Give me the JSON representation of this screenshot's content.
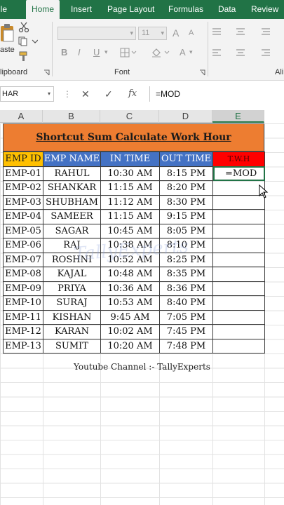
{
  "ribbon": {
    "tabs": [
      {
        "label": "ile",
        "active": false
      },
      {
        "label": "Home",
        "active": true
      },
      {
        "label": "Insert",
        "active": false
      },
      {
        "label": "Page Layout",
        "active": false
      },
      {
        "label": "Formulas",
        "active": false
      },
      {
        "label": "Data",
        "active": false
      },
      {
        "label": "Review",
        "active": false
      }
    ],
    "paste_label": "aste",
    "clipboard_label": "lipboard",
    "font_group_label": "Font",
    "align_group_label": "Ali",
    "font_size_value": "11",
    "bold_label": "B",
    "italic_label": "I",
    "underline_label": "U",
    "grow_font_label": "A",
    "shrink_font_label": "A",
    "font_color_label": "A"
  },
  "formula_bar": {
    "name_box": "HAR",
    "formula": "=MOD"
  },
  "columns": [
    "A",
    "B",
    "C",
    "D",
    "E"
  ],
  "active_column": "E",
  "sheet": {
    "title": "Shortcut Sum Calculate Work Hour",
    "headers": [
      "EMP ID",
      "EMP NAME",
      "IN TIME",
      "OUT TIME",
      "T.W.H"
    ],
    "rows": [
      [
        "EMP-01",
        "RAHUL",
        "10:30 AM",
        "8:15 PM",
        "=MOD"
      ],
      [
        "EMP-02",
        "SHANKAR",
        "11:15 AM",
        "8:20 PM",
        ""
      ],
      [
        "EMP-03",
        "SHUBHAM",
        "11:12 AM",
        "8:30 PM",
        ""
      ],
      [
        "EMP-04",
        "SAMEER",
        "11:15 AM",
        "9:15 PM",
        ""
      ],
      [
        "EMP-05",
        "SAGAR",
        "10:45 AM",
        "8:05 PM",
        ""
      ],
      [
        "EMP-06",
        "RAJ",
        "10:38 AM",
        "8:10 PM",
        ""
      ],
      [
        "EMP-07",
        "ROSHNI",
        "10:52 AM",
        "8:25 PM",
        ""
      ],
      [
        "EMP-08",
        "KAJAL",
        "10:48 AM",
        "8:35 PM",
        ""
      ],
      [
        "EMP-09",
        "PRIYA",
        "10:36 AM",
        "8:36 PM",
        ""
      ],
      [
        "EMP-10",
        "SURAJ",
        "10:53 AM",
        "8:40 PM",
        ""
      ],
      [
        "EMP-11",
        "KISHAN",
        "9:45 AM",
        "7:05 PM",
        ""
      ],
      [
        "EMP-12",
        "KARAN",
        "10:02 AM",
        "7:45 PM",
        ""
      ],
      [
        "EMP-13",
        "SUMIT",
        "10:20 AM",
        "7:48 PM",
        ""
      ]
    ],
    "watermark": "TallyExperts",
    "channel_note": "Youtube Channel :- TallyExperts"
  },
  "colors": {
    "excel_green": "#217346",
    "title_fill": "#ed7d31",
    "header_id_fill": "#ffc000",
    "header_blue_fill": "#4472c4",
    "header_twh_fill": "#ff0000"
  }
}
